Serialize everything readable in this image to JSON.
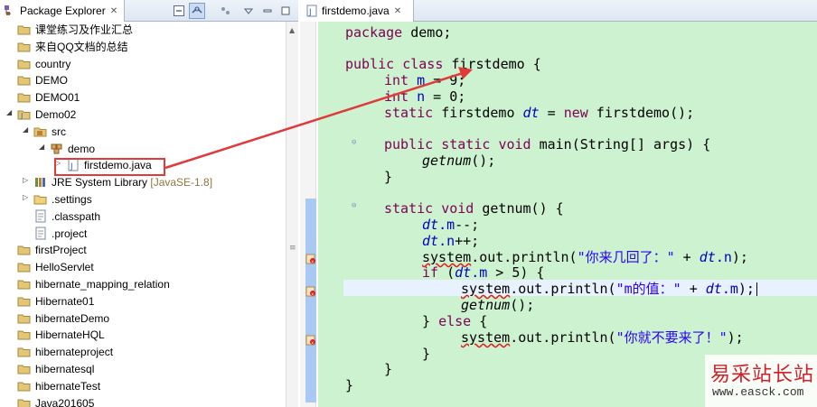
{
  "package_explorer": {
    "title": "Package Explorer",
    "close_glyph": "✕",
    "items": [
      {
        "label": "课堂练习及作业汇总",
        "indent": 0,
        "type": "project"
      },
      {
        "label": "来自QQ文档的总结",
        "indent": 0,
        "type": "project"
      },
      {
        "label": "country",
        "indent": 0,
        "type": "project"
      },
      {
        "label": "DEMO",
        "indent": 0,
        "type": "project"
      },
      {
        "label": "DEMO01",
        "indent": 0,
        "type": "project"
      },
      {
        "label": "Demo02",
        "indent": 0,
        "type": "java-project",
        "expanded": true
      },
      {
        "label": "src",
        "indent": 1,
        "type": "source-folder",
        "expanded": true
      },
      {
        "label": "demo",
        "indent": 2,
        "type": "package",
        "expanded": true
      },
      {
        "label": "firstdemo.java",
        "indent": 3,
        "type": "java-file",
        "selected": true
      },
      {
        "label": "JRE System Library",
        "suffix": "[JavaSE-1.8]",
        "indent": 1,
        "type": "library"
      },
      {
        "label": ".settings",
        "indent": 1,
        "type": "folder"
      },
      {
        "label": ".classpath",
        "indent": 1,
        "type": "file"
      },
      {
        "label": ".project",
        "indent": 1,
        "type": "file"
      },
      {
        "label": "firstProject",
        "indent": 0,
        "type": "project"
      },
      {
        "label": "HelloServlet",
        "indent": 0,
        "type": "project"
      },
      {
        "label": "hibernate_mapping_relation",
        "indent": 0,
        "type": "project"
      },
      {
        "label": "Hibernate01",
        "indent": 0,
        "type": "project"
      },
      {
        "label": "hibernateDemo",
        "indent": 0,
        "type": "project"
      },
      {
        "label": "HibernateHQL",
        "indent": 0,
        "type": "project"
      },
      {
        "label": "hibernateproject",
        "indent": 0,
        "type": "project"
      },
      {
        "label": "hibernatesql",
        "indent": 0,
        "type": "project"
      },
      {
        "label": "hibernateTest",
        "indent": 0,
        "type": "project"
      },
      {
        "label": "Java201605",
        "indent": 0,
        "type": "project"
      }
    ]
  },
  "editor": {
    "tab_title": "firstdemo.java",
    "close_glyph": "✕",
    "code": {
      "l1_kw": "package",
      "l1_rest": " demo;",
      "l2_kw1": "public",
      "l2_kw2": "class",
      "l2_rest": " firstdemo {",
      "l3_kw": "int",
      "l3_var": "m",
      "l3_rest": " = 9;",
      "l4_kw": "int",
      "l4_var": "n",
      "l4_rest": " = 0;",
      "l5_kw": "static",
      "l5_mid": " firstdemo ",
      "l5_var": "dt",
      "l5_eq": " = ",
      "l5_new": "new",
      "l5_rest": " firstdemo();",
      "l6_kw1": "public",
      "l6_kw2": "static",
      "l6_kw3": "void",
      "l6_rest": " main(String[] ",
      "l6_arg": "args",
      "l6_end": ") {",
      "l7_call": "getnum",
      "l7_rest": "();",
      "l8": "}",
      "l9_kw1": "static",
      "l9_kw2": "void",
      "l9_rest": " getnum() {",
      "l10_var": "dt",
      "l10_fld": ".m",
      "l10_rest": "--;",
      "l11_var": "dt",
      "l11_fld": ".n",
      "l11_rest": "++;",
      "l12_sys": "system",
      "l12_mid": ".out.println(",
      "l12_str": "\"你来几回了：\"",
      "l12_plus": " + ",
      "l12_var": "dt",
      "l12_fld": ".n",
      "l12_end": ");",
      "l13_kw": "if",
      "l13_open": " (",
      "l13_var": "dt",
      "l13_fld": ".m",
      "l13_rest": " > 5) {",
      "l14_sys": "system",
      "l14_mid": ".out.println(",
      "l14_str": "\"m的值：\"",
      "l14_plus": " + ",
      "l14_var": "dt",
      "l14_fld": ".m",
      "l14_end": ");",
      "l15_call": "getnum",
      "l15_rest": "();",
      "l16_pre": "} ",
      "l16_kw": "else",
      "l16_rest": " {",
      "l17_sys": "system",
      "l17_mid": ".out.println(",
      "l17_str": "\"你就不要来了！\"",
      "l17_end": ");",
      "l18": "}",
      "l19": "}",
      "l20": "}"
    }
  },
  "watermark": {
    "title": "易采站长站",
    "url": "www.easck.com"
  },
  "colors": {
    "editor_bg": "#ccf2cf",
    "keyword": "#7f0055",
    "field": "#0000c0",
    "string": "#2a00ff",
    "annotation_red": "#e03a3a"
  }
}
